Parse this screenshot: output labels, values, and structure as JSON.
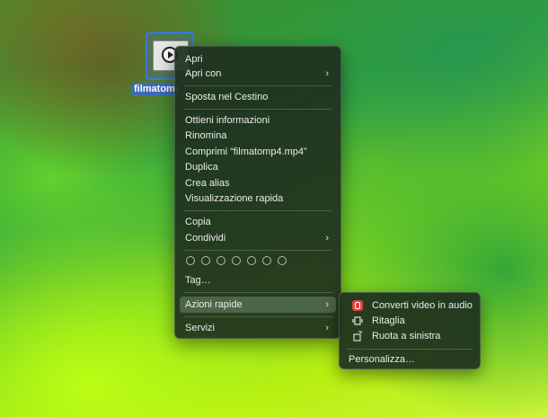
{
  "desktop": {
    "file_name": "filmatomp4"
  },
  "context_menu": {
    "open": "Apri",
    "open_with": "Apri con",
    "move_to_trash": "Sposta nel Cestino",
    "get_info": "Ottieni informazioni",
    "rename": "Rinomina",
    "compress": "Comprimi “filmatomp4.mp4”",
    "duplicate": "Duplica",
    "make_alias": "Crea alias",
    "quick_look": "Visualizzazione rapida",
    "copy": "Copia",
    "share": "Condividi",
    "tags": "Tag…",
    "quick_actions": "Azioni rapide",
    "services": "Servizi",
    "chevron": "›"
  },
  "quick_actions_submenu": {
    "items": [
      {
        "label": "Converti video in audio",
        "icon": "convert-video-icon",
        "color": "#e0443c"
      },
      {
        "label": "Ritaglia",
        "icon": "trim-icon"
      },
      {
        "label": "Ruota a sinistra",
        "icon": "rotate-left-icon"
      }
    ],
    "customize": "Personalizza…"
  },
  "colors": {
    "menu_bg": "#1e301e",
    "selection_blue": "#3c78d8"
  }
}
